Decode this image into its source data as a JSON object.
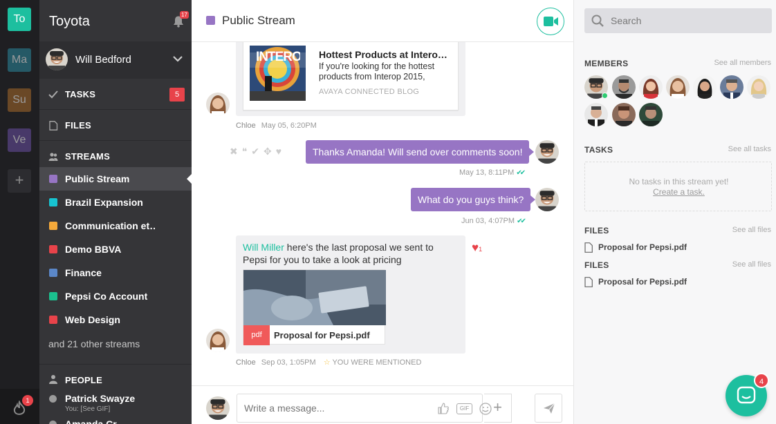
{
  "workspaces": [
    {
      "abbr": "To",
      "color": "#1dbf9f"
    },
    {
      "abbr": "Ma",
      "color": "#2a8a9e"
    },
    {
      "abbr": "Su",
      "color": "#a86a2a"
    },
    {
      "abbr": "Ve",
      "color": "#6b4fa3"
    }
  ],
  "rail": {
    "add": "+",
    "notif_count": "1"
  },
  "sidebar": {
    "org": "Toyota",
    "bell_count": "17",
    "user_name": "Will Bedford",
    "tasks_label": "TASKS",
    "tasks_count": "5",
    "files_label": "FILES",
    "streams_label": "STREAMS",
    "streams": [
      {
        "label": "Public Stream",
        "color": "#9775c4"
      },
      {
        "label": "Brazil Expansion",
        "color": "#17c4d1"
      },
      {
        "label": "Communication et…",
        "color": "#f5a93a"
      },
      {
        "label": "Demo BBVA",
        "color": "#e8434a"
      },
      {
        "label": "Finance",
        "color": "#5b87c8"
      },
      {
        "label": "Pepsi Co Account",
        "color": "#1bc08e"
      },
      {
        "label": "Web Design",
        "color": "#e8434a"
      }
    ],
    "other_streams": "and 21 other streams",
    "people_label": "PEOPLE",
    "person_name": "Patrick Swayze",
    "person_status": "You: [See GIF]",
    "person2": "Amanda Cr…"
  },
  "header": {
    "title": "Public Stream",
    "color": "#9775c4"
  },
  "feed": {
    "link_card": {
      "title": "Hottest Products at Intero…",
      "desc": "If you're looking for the hottest products from Interop 2015,",
      "source": "AVAYA CONNECTED BLOG",
      "image_text": "INTERO"
    },
    "meta1": {
      "author": "Chloe",
      "time": "May 05, 6:20PM"
    },
    "msg2": {
      "text": "Thanks Amanda! Will send over comments soon!",
      "time": "May 13, 8:11PM"
    },
    "msg3": {
      "text": "What do you guys think?",
      "time": "Jun 03, 4:07PM"
    },
    "msg4": {
      "mention": "Will Miller",
      "text": " here's the last proposal we sent to Pepsi for you to take a look at pricing",
      "file_type": "pdf",
      "file_name": "Proposal for Pepsi.pdf",
      "like_count": "1"
    },
    "meta4": {
      "author": "Chloe",
      "time": "Sep 03, 1:05PM",
      "mention_note": "YOU WERE MENTIONED"
    }
  },
  "composer": {
    "placeholder": "Write a message...",
    "gif": "GIF"
  },
  "right": {
    "search_placeholder": "Search",
    "members_label": "MEMBERS",
    "members_link": "See all members",
    "tasks_label": "TASKS",
    "tasks_link": "See all tasks",
    "empty_tasks": "No tasks in this stream yet!",
    "create_task": "Create a task.",
    "files_label": "FILES",
    "files_link": "See all files",
    "file1": "Proposal for Pepsi.pdf",
    "files_label2": "FILES",
    "files_link2": "See all files",
    "file2": "Proposal for Pepsi.pdf"
  },
  "chat_launcher": {
    "count": "4"
  },
  "colors": {
    "accent": "#1dbf9f",
    "purple": "#9775c4",
    "badge": "#e8434a"
  }
}
